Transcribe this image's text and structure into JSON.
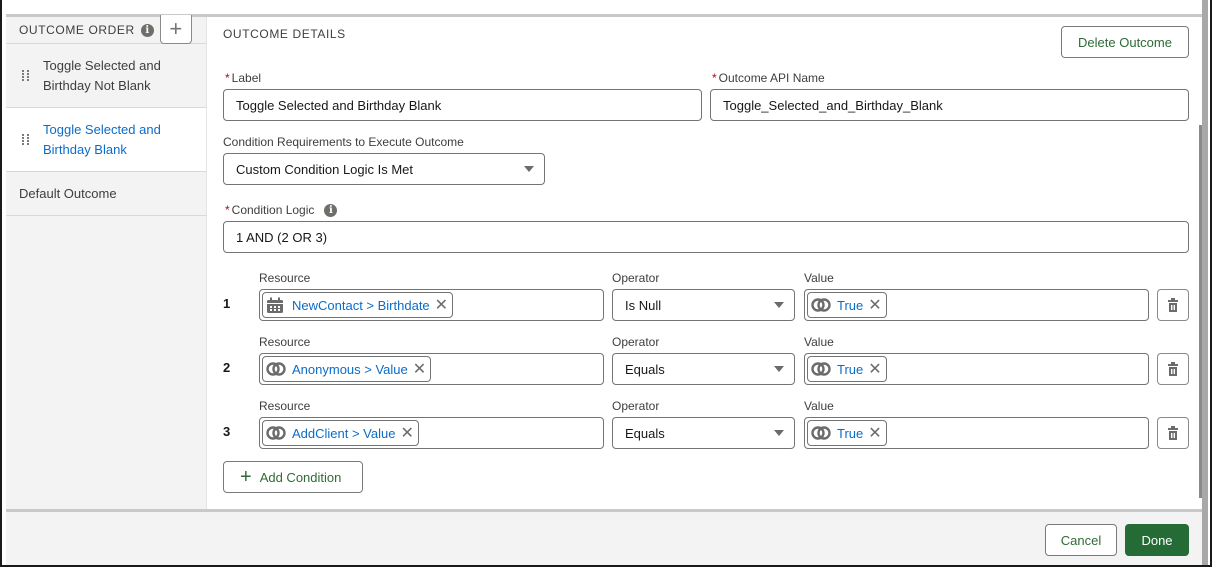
{
  "sidebar": {
    "title": "OUTCOME ORDER",
    "add_label": "+",
    "items": [
      {
        "label": "Toggle Selected and Birthday Not Blank",
        "line1": "Toggle Selected and",
        "line2": "Birthday Not Blank",
        "selected": false
      },
      {
        "label": "Toggle Selected and Birthday Blank",
        "line1": "Toggle Selected and",
        "line2": "Birthday Blank",
        "selected": true
      },
      {
        "label": "Default Outcome"
      }
    ]
  },
  "details": {
    "section_title": "OUTCOME DETAILS",
    "delete_label": "Delete Outcome",
    "label_field": {
      "required": "*",
      "label": "Label",
      "value": "Toggle Selected and Birthday Blank"
    },
    "api_name_field": {
      "required": "*",
      "label": "Outcome API Name",
      "value": "Toggle_Selected_and_Birthday_Blank"
    },
    "condition_requirements": {
      "label": "Condition Requirements to Execute Outcome",
      "value": "Custom Condition Logic Is Met"
    },
    "condition_logic": {
      "required": "*",
      "label": "Condition Logic",
      "value": "1 AND (2 OR 3)"
    },
    "column_labels": {
      "resource": "Resource",
      "operator": "Operator",
      "value": "Value"
    },
    "conditions": [
      {
        "num": "1",
        "resource": "NewContact > Birthdate",
        "resource_icon": "calendar-icon",
        "operator": "Is Null",
        "value": "True",
        "value_icon": "toggle-icon"
      },
      {
        "num": "2",
        "resource": "Anonymous > Value",
        "resource_icon": "toggle-icon",
        "operator": "Equals",
        "value": "True",
        "value_icon": "toggle-icon"
      },
      {
        "num": "3",
        "resource": "AddClient > Value",
        "resource_icon": "toggle-icon",
        "operator": "Equals",
        "value": "True",
        "value_icon": "toggle-icon"
      }
    ],
    "add_condition_label": "Add Condition"
  },
  "footer": {
    "cancel_label": "Cancel",
    "done_label": "Done"
  },
  "colors": {
    "accent_blue": "#0b6cc9",
    "brand_green": "#256b35",
    "required_red": "#ba0517"
  }
}
